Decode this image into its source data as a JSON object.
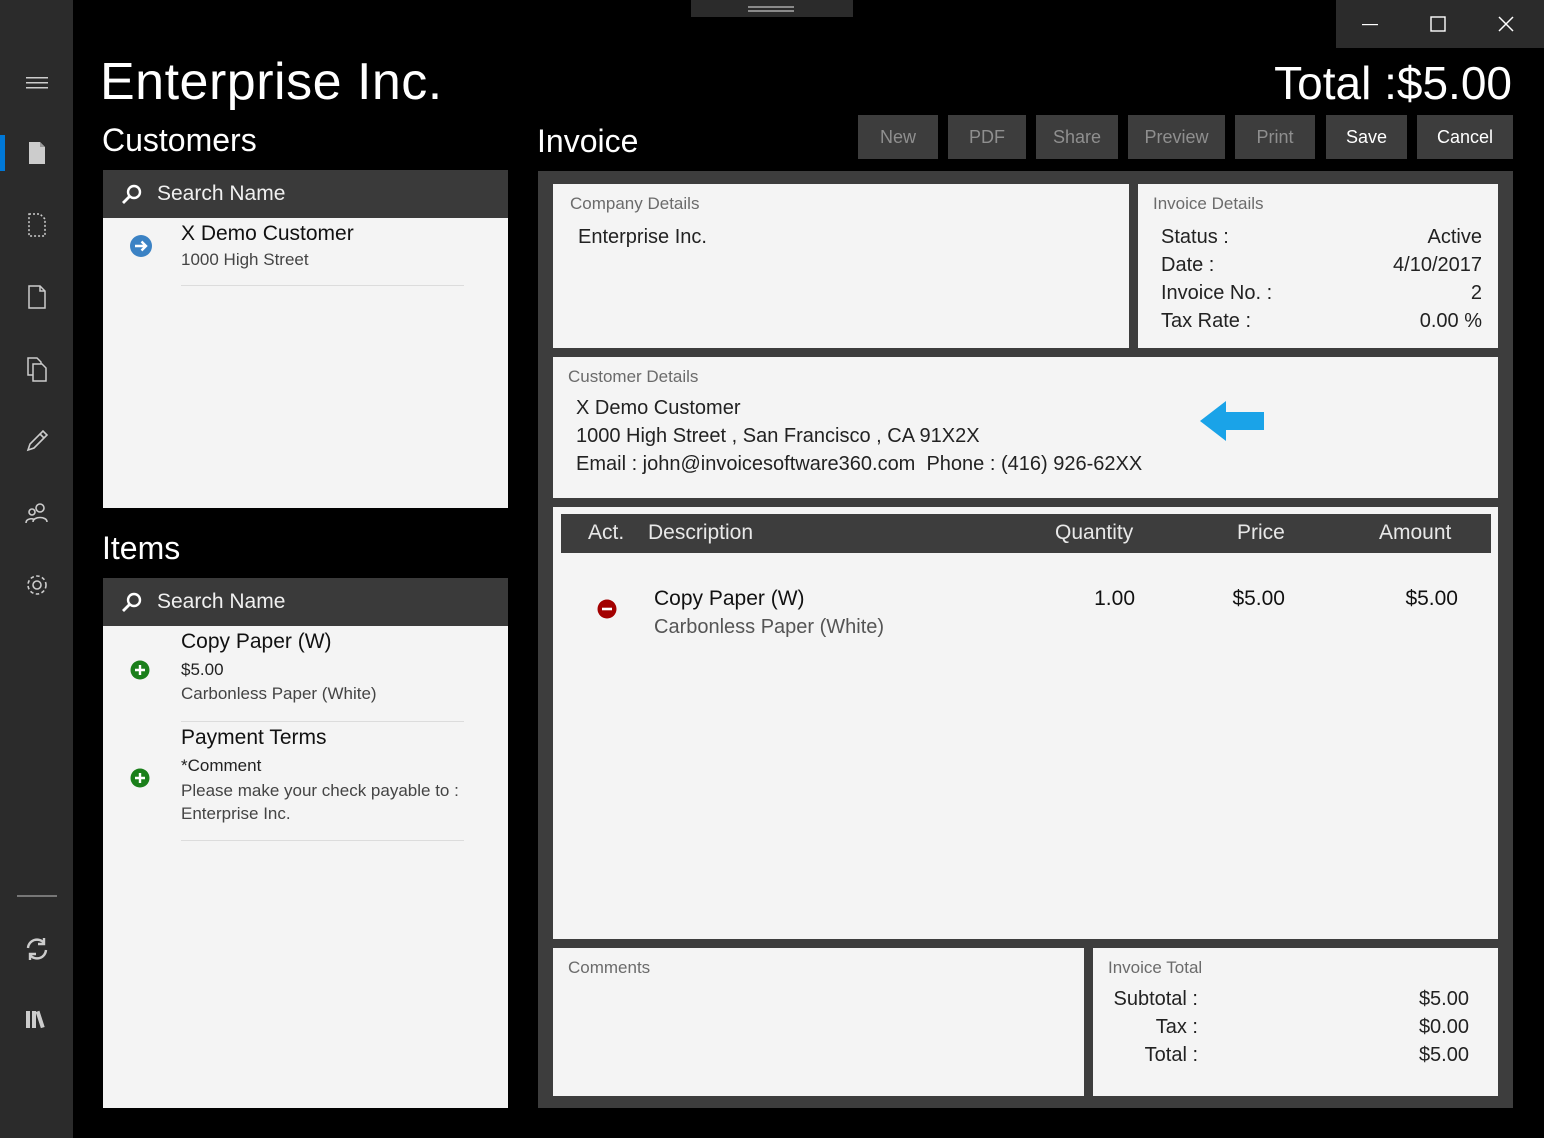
{
  "app": {
    "title": "Enterprise Inc.",
    "total_heading": "Total :$5.00"
  },
  "rail": {
    "items": [
      {
        "icon": "hamburger-menu-icon"
      },
      {
        "icon": "document-icon",
        "active": true
      },
      {
        "icon": "document-dashed-icon"
      },
      {
        "icon": "document-outline-icon"
      },
      {
        "icon": "copy-icon"
      },
      {
        "icon": "pencil-icon"
      },
      {
        "icon": "people-icon"
      },
      {
        "icon": "gear-icon"
      },
      {
        "icon": "sync-icon"
      },
      {
        "icon": "library-icon"
      }
    ]
  },
  "customers": {
    "title": "Customers",
    "search_placeholder": "Search Name",
    "list": [
      {
        "name": "X Demo Customer",
        "address": "1000 High Street"
      }
    ]
  },
  "items": {
    "title": "Items",
    "search_placeholder": "Search Name",
    "list": [
      {
        "name": "Copy Paper (W)",
        "price": "$5.00",
        "desc": "Carbonless Paper (White)"
      },
      {
        "name": "Payment Terms",
        "price": "*Comment",
        "desc_line1": "Please make your check payable to :",
        "desc_line2": "Enterprise Inc."
      }
    ]
  },
  "invoice": {
    "title": "Invoice",
    "toolbar": {
      "new": "New",
      "pdf": "PDF",
      "share": "Share",
      "preview": "Preview",
      "print": "Print",
      "save": "Save",
      "cancel": "Cancel"
    },
    "company": {
      "label": "Company Details",
      "name": "Enterprise Inc."
    },
    "details": {
      "label": "Invoice Details",
      "status_label": "Status :",
      "status": "Active",
      "date_label": "Date :",
      "date": "4/10/2017",
      "number_label": "Invoice No. :",
      "number": "2",
      "tax_label": "Tax Rate :",
      "tax": "0.00 %"
    },
    "customer": {
      "label": "Customer Details",
      "name": "X Demo Customer",
      "address": "1000 High Street , San Francisco , CA 91X2X",
      "contact": "Email : john@invoicesoftware360.com  Phone : (416) 926-62XX"
    },
    "table": {
      "headers": {
        "act": "Act.",
        "description": "Description",
        "quantity": "Quantity",
        "price": "Price",
        "amount": "Amount"
      },
      "rows": [
        {
          "name": "Copy Paper (W)",
          "desc": "Carbonless Paper (White)",
          "quantity": "1.00",
          "price": "$5.00",
          "amount": "$5.00"
        }
      ]
    },
    "comments": {
      "label": "Comments"
    },
    "totals": {
      "label": "Invoice Total",
      "subtotal_label": "Subtotal :",
      "subtotal": "$5.00",
      "tax_label": "Tax :",
      "tax": "$0.00",
      "total_label": "Total :",
      "total": "$5.00"
    }
  },
  "colors": {
    "accent": "#0078d7",
    "arrow": "#1aa3e8",
    "add": "#1a7f1a",
    "remove": "#a30000",
    "customer_arrow": "#3b82c4"
  }
}
